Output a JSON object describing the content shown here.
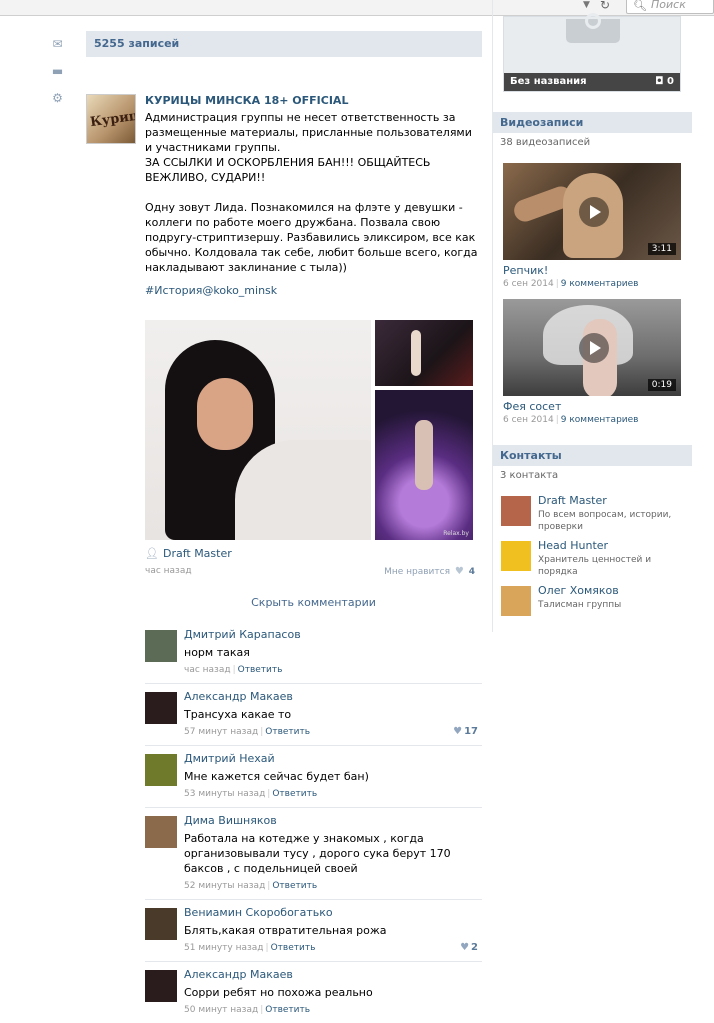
{
  "browser": {
    "search_placeholder": "Поиск"
  },
  "left_icons": [
    "mail-icon",
    "chat-icon",
    "gear-icon"
  ],
  "wall": {
    "count": "5255 записей"
  },
  "post": {
    "author": "КУРИЦЫ МИНСКА 18+ OFFICIAL",
    "avatar_text": "Курицы",
    "text": "Администрация группы не несет ответственность за размещенные материалы, присланные пользователями и участниками группы.\nЗА ССЫЛКИ И ОСКОРБЛЕНИЯ БАН!!! ОБЩАЙТЕСЬ ВЕЖЛИВО, СУДАРИ!!\n\nОдну зовут Лида. Познакомился на флэте у девушки - коллеги по работе моего дружбана. Позвала свою подругу-стриптизершу. Разбавились эликсиром, все как обычно. Колдовала так себе, любит больше всего, когда накладывают заклинание с тыла))",
    "tag": "#История@koko_minsk",
    "signer": "Draft Master",
    "time": "час назад",
    "like_label": "Мне нравится",
    "likes": "4",
    "hide_comments": "Скрыть комментарии",
    "watermark": "Relax.by"
  },
  "comments": [
    {
      "name": "Дмитрий Карапасов",
      "text": "норм такая",
      "time": "час назад",
      "reply": "Ответить",
      "likes": "",
      "avatar_color": "#5b6b55"
    },
    {
      "name": "Александр Макаев",
      "text": "Трансуха какае то",
      "time": "57 минут назад",
      "reply": "Ответить",
      "likes": "17",
      "avatar_color": "#2a1c1c"
    },
    {
      "name": "Дмитрий Нехай",
      "text": "Мне кажется сейчас будет бан)",
      "time": "53 минуты назад",
      "reply": "Ответить",
      "likes": "",
      "avatar_color": "#6f7a2a"
    },
    {
      "name": "Дима Вишняков",
      "text": "Работала на котедже у знакомых , когда организовывали тусу , дорого сука берут 170 баксов , с подельницей своей",
      "time": "52 минуты назад",
      "reply": "Ответить",
      "likes": "",
      "avatar_color": "#8a6a4a"
    },
    {
      "name": "Вениамин Скоробогатько",
      "text": "Блять,какая отвратительная рожа",
      "time": "51 минуту назад",
      "reply": "Ответить",
      "likes": "2",
      "avatar_color": "#4a3a2a"
    },
    {
      "name": "Александр Макаев",
      "text": "Сорри ребят но похожа реально",
      "time": "50 минут назад",
      "reply": "Ответить",
      "likes": "",
      "avatar_color": "#2a1c1c"
    }
  ],
  "sidebar": {
    "album": {
      "title": "Без названия",
      "count": "0"
    },
    "videos": {
      "header": "Видеозаписи",
      "count": "38 видеозаписей",
      "items": [
        {
          "title": "Репчик!",
          "date": "6 сен 2014",
          "comments": "9 комментариев",
          "duration": "3:11"
        },
        {
          "title": "Фея сосет",
          "date": "6 сен 2014",
          "comments": "9 комментариев",
          "duration": "0:19"
        }
      ]
    },
    "contacts": {
      "header": "Контакты",
      "count": "3 контакта",
      "items": [
        {
          "name": "Draft Master",
          "desc": "По всем вопросам, истории, проверки",
          "avatar_color": "#b5654a"
        },
        {
          "name": "Head Hunter",
          "desc": "Хранитель ценностей и порядка",
          "avatar_color": "#f0c020"
        },
        {
          "name": "Олег Хомяков",
          "desc": "Талисман группы",
          "avatar_color": "#d9a55a"
        }
      ]
    }
  }
}
